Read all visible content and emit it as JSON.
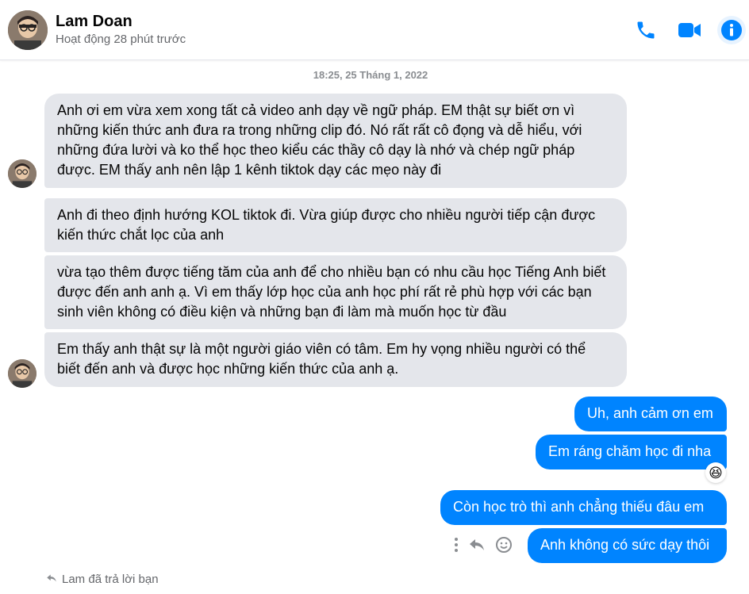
{
  "header": {
    "contact_name": "Lam Doan",
    "status": "Hoạt động 28 phút trước",
    "icons": [
      "phone-icon",
      "video-camera-icon",
      "info-icon"
    ],
    "accent_color": "#0084ff"
  },
  "timestamp": "18:25, 25 Tháng 1, 2022",
  "messages": {
    "incoming": [
      {
        "text": "Anh ơi em vừa xem xong tất cả video anh dạy về ngữ pháp. EM thật sự biết ơn vì những kiến thức anh đưa ra trong những clip đó. Nó rất rất cô đọng và dễ hiểu, với những đứa lười và ko thể học theo kiểu các thầy cô dạy là nhớ và chép ngữ pháp được. EM thấy anh nên lập 1 kênh tiktok dạy các mẹo này đi"
      },
      {
        "text": "Anh đi theo định hướng KOL tiktok đi. Vừa giúp được cho nhiều người tiếp cận được kiến thức chắt lọc của anh"
      },
      {
        "text": "vừa tạo thêm được tiếng tăm của anh để cho nhiều bạn có nhu cầu học Tiếng Anh biết được đến anh anh ạ. Vì em thấy lớp học của anh học phí rất rẻ phù hợp với các bạn sinh viên không có điều kiện và những bạn đi làm mà muốn học từ đầu"
      },
      {
        "text": "Em thấy anh thật sự là một người giáo viên có tâm. Em hy vọng nhiều người có thể biết đến anh và được học những kiến thức của anh ạ."
      }
    ],
    "outgoing": [
      {
        "text": "Uh, anh cảm ơn em"
      },
      {
        "text": "Em ráng chăm học đi nha",
        "reaction": "😆"
      },
      {
        "text": "Còn học trò thì anh chẳng thiếu đâu em"
      },
      {
        "text": "Anh không có sức dạy thôi"
      }
    ]
  },
  "footer": {
    "reply_note": "Lam đã trả lời bạn"
  }
}
